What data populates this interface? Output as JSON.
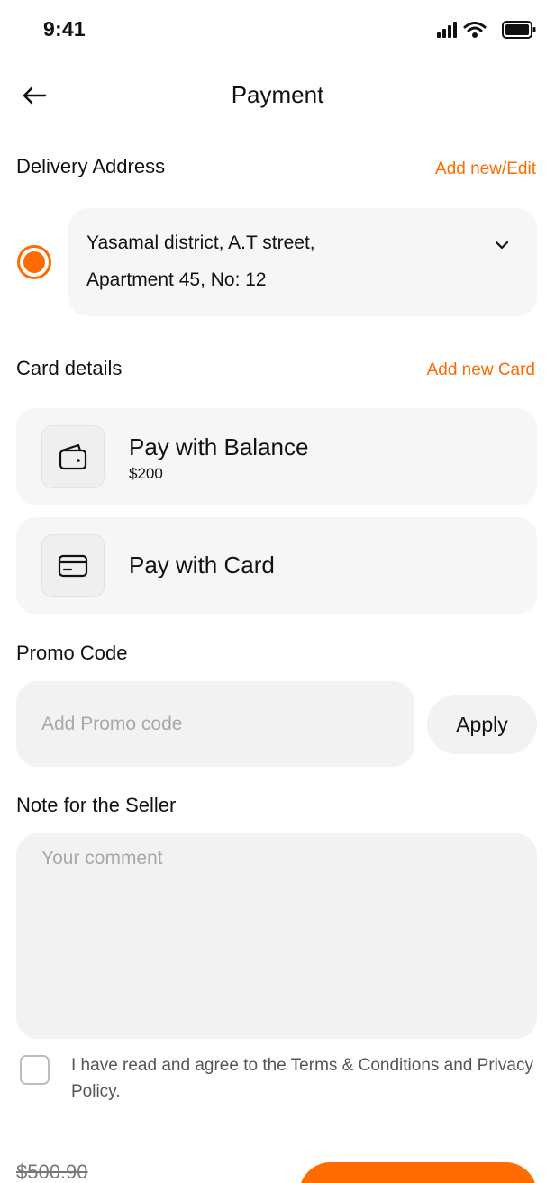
{
  "status_bar": {
    "time": "9:41",
    "icons": [
      "signal-icon",
      "wifi-icon",
      "battery-icon"
    ]
  },
  "header": {
    "back_icon": "back-arrow-icon",
    "title": "Payment"
  },
  "delivery": {
    "label": "Delivery Address",
    "action": "Add new/Edit",
    "selected": true,
    "address_line1": "Yasamal district, A.T street,",
    "address_line2": "Apartment 45, No: 12",
    "chevron_icon": "chevron-down-icon"
  },
  "card_details": {
    "label": "Card details",
    "action": "Add new Card",
    "options": [
      {
        "title": "Pay with Balance",
        "subtitle": "$200",
        "icon": "wallet-icon"
      },
      {
        "title": "Pay with Card",
        "icon": "credit-card-icon"
      }
    ]
  },
  "promo": {
    "label": "Promo Code",
    "placeholder": "Add Promo code",
    "value": "",
    "apply_label": "Apply"
  },
  "note": {
    "label": "Note for the Seller",
    "placeholder": "Your comment",
    "value": ""
  },
  "terms": {
    "text": "I have read and agree to the Terms & Conditions and Privacy Policy.",
    "checked": false
  },
  "footer": {
    "old_price": "$500.90"
  },
  "colors": {
    "accent": "#FF6B00",
    "card_bg": "#F6F6F6",
    "input_bg": "#F2F2F2"
  }
}
